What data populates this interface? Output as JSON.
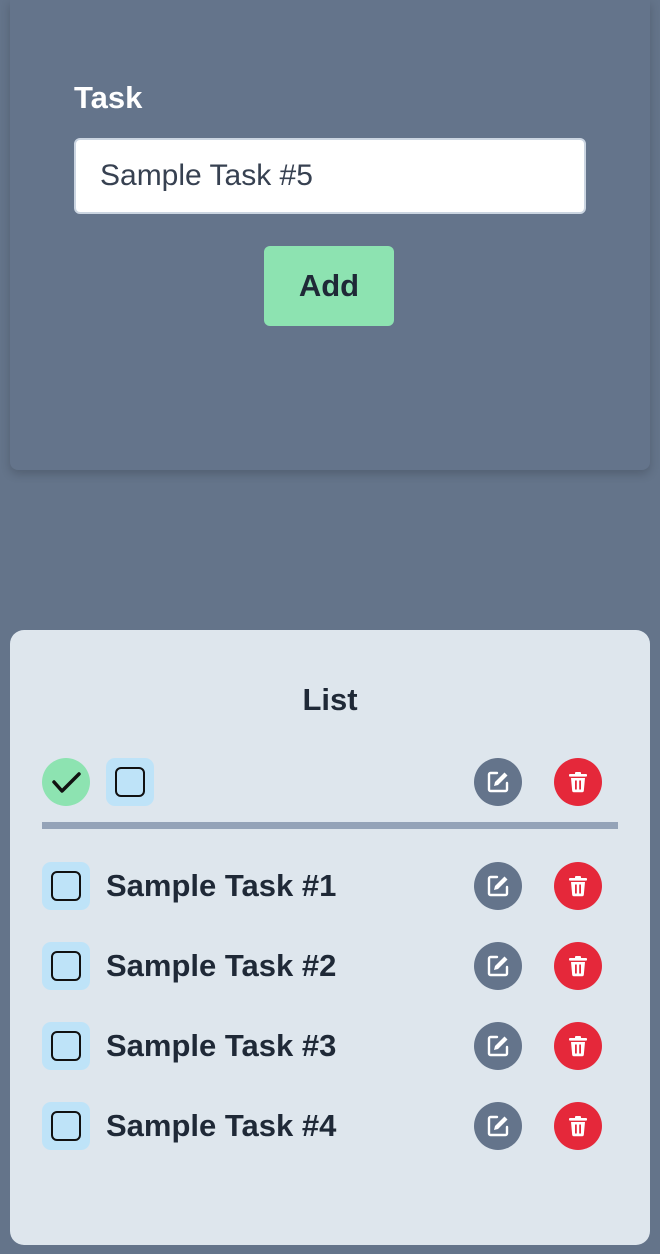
{
  "form": {
    "task_label": "Task",
    "task_input_value": "Sample Task #5",
    "add_button_label": "Add"
  },
  "list": {
    "title": "List",
    "header": {
      "toggle_all_icon": "check-circle-icon",
      "select_all_icon": "checkbox-icon",
      "edit_icon": "edit-icon",
      "delete_icon": "trash-icon"
    },
    "items": [
      {
        "label": "Sample Task #1",
        "checked": false
      },
      {
        "label": "Sample Task #2",
        "checked": false
      },
      {
        "label": "Sample Task #3",
        "checked": false
      },
      {
        "label": "Sample Task #4",
        "checked": false
      }
    ]
  },
  "colors": {
    "background": "#64748a",
    "add_button": "#8de3b1",
    "checkbox_bg": "#bee3f8",
    "edit_button": "#64748b",
    "delete_button": "#e5283a",
    "list_card": "#dee6ed",
    "divider": "#94a3b8"
  }
}
